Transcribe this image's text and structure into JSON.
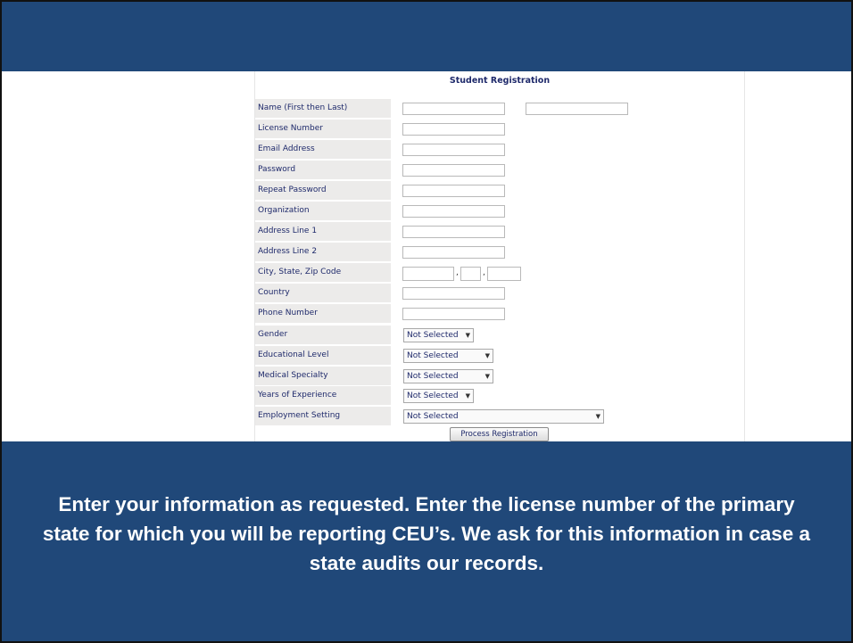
{
  "form": {
    "title": "Student Registration",
    "labels": {
      "name": "Name (First then Last)",
      "license": "License Number",
      "email": "Email Address",
      "password": "Password",
      "repeat_password": "Repeat Password",
      "organization": "Organization",
      "address1": "Address Line 1",
      "address2": "Address Line 2",
      "city_state_zip": "City, State, Zip Code",
      "country": "Country",
      "phone": "Phone Number",
      "gender": "Gender",
      "education": "Educational Level",
      "specialty": "Medical Specialty",
      "experience": "Years of Experience",
      "employment": "Employment Setting"
    },
    "values": {
      "first_name": "",
      "last_name": "",
      "license": "",
      "email": "",
      "password": "",
      "repeat_password": "",
      "organization": "",
      "address1": "",
      "address2": "",
      "city": "",
      "state": "",
      "zip": "",
      "country": "",
      "phone": ""
    },
    "separator": ",",
    "selects": {
      "gender": "Not Selected",
      "education": "Not Selected",
      "specialty": "Not Selected",
      "experience": "Not Selected",
      "employment": "Not Selected"
    },
    "submit_label": "Process Registration"
  },
  "caption": "Enter your information as requested.  Enter the license number of the primary state for which you will be reporting CEU’s.  We ask for this information in case a state audits our records.",
  "colors": {
    "band": "#204879",
    "label_bg": "#ecebea",
    "label_text": "#1f2a6b"
  },
  "icons": {
    "dropdown": "chevron-down-icon"
  }
}
